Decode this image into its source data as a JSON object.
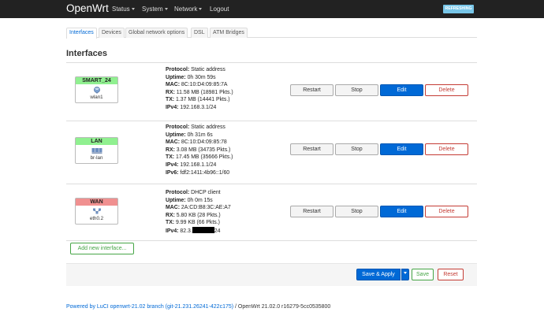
{
  "nav": {
    "brand": "OpenWrt",
    "items": [
      "Status",
      "System",
      "Network",
      "Logout"
    ],
    "refresh_badge": "REFRESHING"
  },
  "tabs": [
    "Interfaces",
    "Devices",
    "Global network options",
    "DSL",
    "ATM Bridges"
  ],
  "page_title": "Interfaces",
  "labels": {
    "protocol": "Protocol:",
    "uptime": "Uptime:",
    "mac": "MAC:",
    "rx": "RX:",
    "tx": "TX:",
    "ipv4": "IPv4:",
    "ipv6": "IPv6:"
  },
  "interfaces": [
    {
      "name": "SMART_24",
      "device": "wlan1",
      "color": "#90f090",
      "protocol": "Static address",
      "uptime": "0h 30m 59s",
      "mac": "8C:10:D4:09:85:7A",
      "rx": "11.58 MB (18981 Pkts.)",
      "tx": "1.37 MB (14441 Pkts.)",
      "ipv4": "192.168.3.1/24"
    },
    {
      "name": "LAN",
      "device": "br-lan",
      "color": "#90f090",
      "protocol": "Static address",
      "uptime": "0h 31m 6s",
      "mac": "8C:10:D4:09:85:78",
      "rx": "3.08 MB (34735 Pkts.)",
      "tx": "17.45 MB (35666 Pkts.)",
      "ipv4": "192.168.1.1/24",
      "ipv6": "fdf2:1411:4b96::1/60"
    },
    {
      "name": "WAN",
      "device": "eth0.2",
      "color": "#f09090",
      "protocol": "DHCP client",
      "uptime": "0h 0m 15s",
      "mac": "2A:CD:B8:3C:AE:A7",
      "rx": "5.80 KB (28 Pkts.)",
      "tx": "9.99 KB (66 Pkts.)",
      "ipv4_prefix": "82.3.",
      "ipv4_suffix": "24"
    }
  ],
  "row_buttons": {
    "restart": "Restart",
    "stop": "Stop",
    "edit": "Edit",
    "delete": "Delete"
  },
  "add_interface": "Add new interface...",
  "actions": {
    "save_apply": "Save & Apply",
    "save": "Save",
    "reset": "Reset"
  },
  "footer": {
    "link": "Powered by LuCI openwrt-21.02 branch (git-21.231.26241-422c175)",
    "text": " / OpenWrt 21.02.0 r16279-5cc0535800"
  }
}
